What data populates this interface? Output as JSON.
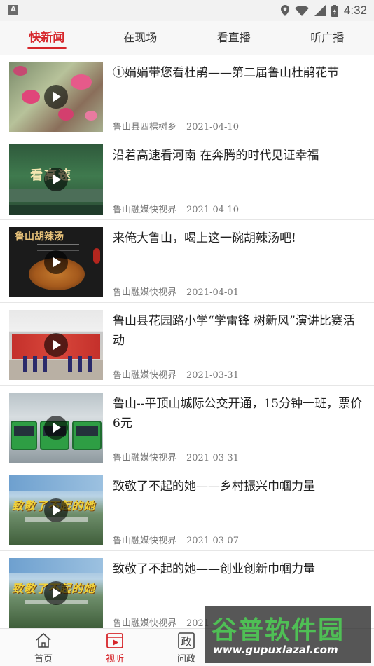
{
  "status_bar": {
    "left_badge": "A",
    "time": "4:32",
    "icons": [
      "location-icon",
      "wifi-icon",
      "signal-icon",
      "battery-icon"
    ]
  },
  "tabs": [
    {
      "label": "快新闻",
      "active": true
    },
    {
      "label": "在现场",
      "active": false
    },
    {
      "label": "看直播",
      "active": false
    },
    {
      "label": "听广播",
      "active": false
    }
  ],
  "news": [
    {
      "title": "①娟娟带您看杜鹃——第二届鲁山杜鹃花节",
      "source": "鲁山县四棵树乡",
      "date": "2021-04-10",
      "thumb": "flowers-scene"
    },
    {
      "title": "沿着高速看河南 在奔腾的时代见证幸福",
      "source": "鲁山融媒快视界",
      "date": "2021-04-10",
      "thumb": "highway-scene",
      "thumb_text": "看高速"
    },
    {
      "title": "来俺大鲁山，喝上这一碗胡辣汤吧!",
      "source": "鲁山融媒快视界",
      "date": "2021-04-01",
      "thumb": "soup-scene",
      "thumb_text": "鲁山胡辣汤"
    },
    {
      "title": "鲁山县花园路小学“学雷锋 树新风”演讲比赛活动",
      "source": "鲁山融媒快视界",
      "date": "2021-03-31",
      "thumb": "stage-scene"
    },
    {
      "title": "鲁山--平顶山城际公交开通，15分钟一班，票价6元",
      "source": "鲁山融媒快视界",
      "date": "2021-03-31",
      "thumb": "bus-scene"
    },
    {
      "title": "致敬了不起的她——乡村振兴巾帼力量",
      "source": "鲁山融媒快视界",
      "date": "2021-03-07",
      "thumb": "sunset-scene",
      "thumb_text": "致敬了不起的她"
    },
    {
      "title": "致敬了不起的她——创业创新巾帼力量",
      "source": "鲁山融媒快视界",
      "date": "2021",
      "thumb": "sunset-scene",
      "thumb_text": "致敬了不起的她"
    }
  ],
  "bottom_nav": [
    {
      "label": "首页",
      "icon": "home-icon",
      "active": false
    },
    {
      "label": "视听",
      "icon": "video-icon",
      "active": true
    },
    {
      "label": "问政",
      "icon": "politics-icon",
      "active": false,
      "icon_text": "政"
    }
  ],
  "watermark": {
    "main": "谷普软件园",
    "url": "www.gupuxlazal.com"
  },
  "colors": {
    "accent": "#d6262b",
    "tab_bg": "#f7f7f7",
    "meta_text": "#777777"
  }
}
